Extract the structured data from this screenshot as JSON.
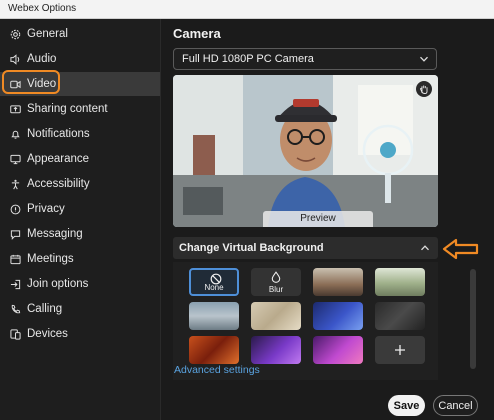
{
  "window": {
    "title": "Webex Options"
  },
  "sidebar": {
    "items": [
      {
        "label": "General",
        "icon": "gear-icon"
      },
      {
        "label": "Audio",
        "icon": "speaker-icon"
      },
      {
        "label": "Video",
        "icon": "video-icon",
        "active": true
      },
      {
        "label": "Sharing content",
        "icon": "share-icon"
      },
      {
        "label": "Notifications",
        "icon": "bell-icon"
      },
      {
        "label": "Appearance",
        "icon": "palette-icon"
      },
      {
        "label": "Accessibility",
        "icon": "accessibility-icon"
      },
      {
        "label": "Privacy",
        "icon": "privacy-icon"
      },
      {
        "label": "Messaging",
        "icon": "chat-icon"
      },
      {
        "label": "Meetings",
        "icon": "meetings-icon"
      },
      {
        "label": "Join options",
        "icon": "join-icon"
      },
      {
        "label": "Calling",
        "icon": "phone-icon"
      },
      {
        "label": "Devices",
        "icon": "devices-icon"
      }
    ]
  },
  "main": {
    "section_title": "Camera",
    "camera_select": {
      "value": "Full HD 1080P PC Camera"
    },
    "preview": {
      "label": "Preview"
    },
    "virtual_background": {
      "title": "Change Virtual Background",
      "tiles": [
        {
          "label": "None",
          "selected": true
        },
        {
          "label": "Blur"
        }
      ]
    },
    "advanced_link": "Advanced settings",
    "buttons": {
      "save": "Save",
      "cancel": "Cancel"
    }
  },
  "colors": {
    "accent_blue": "#5aa3e0",
    "highlight_orange": "#f08a24",
    "selected_border": "#4e8fd8"
  }
}
